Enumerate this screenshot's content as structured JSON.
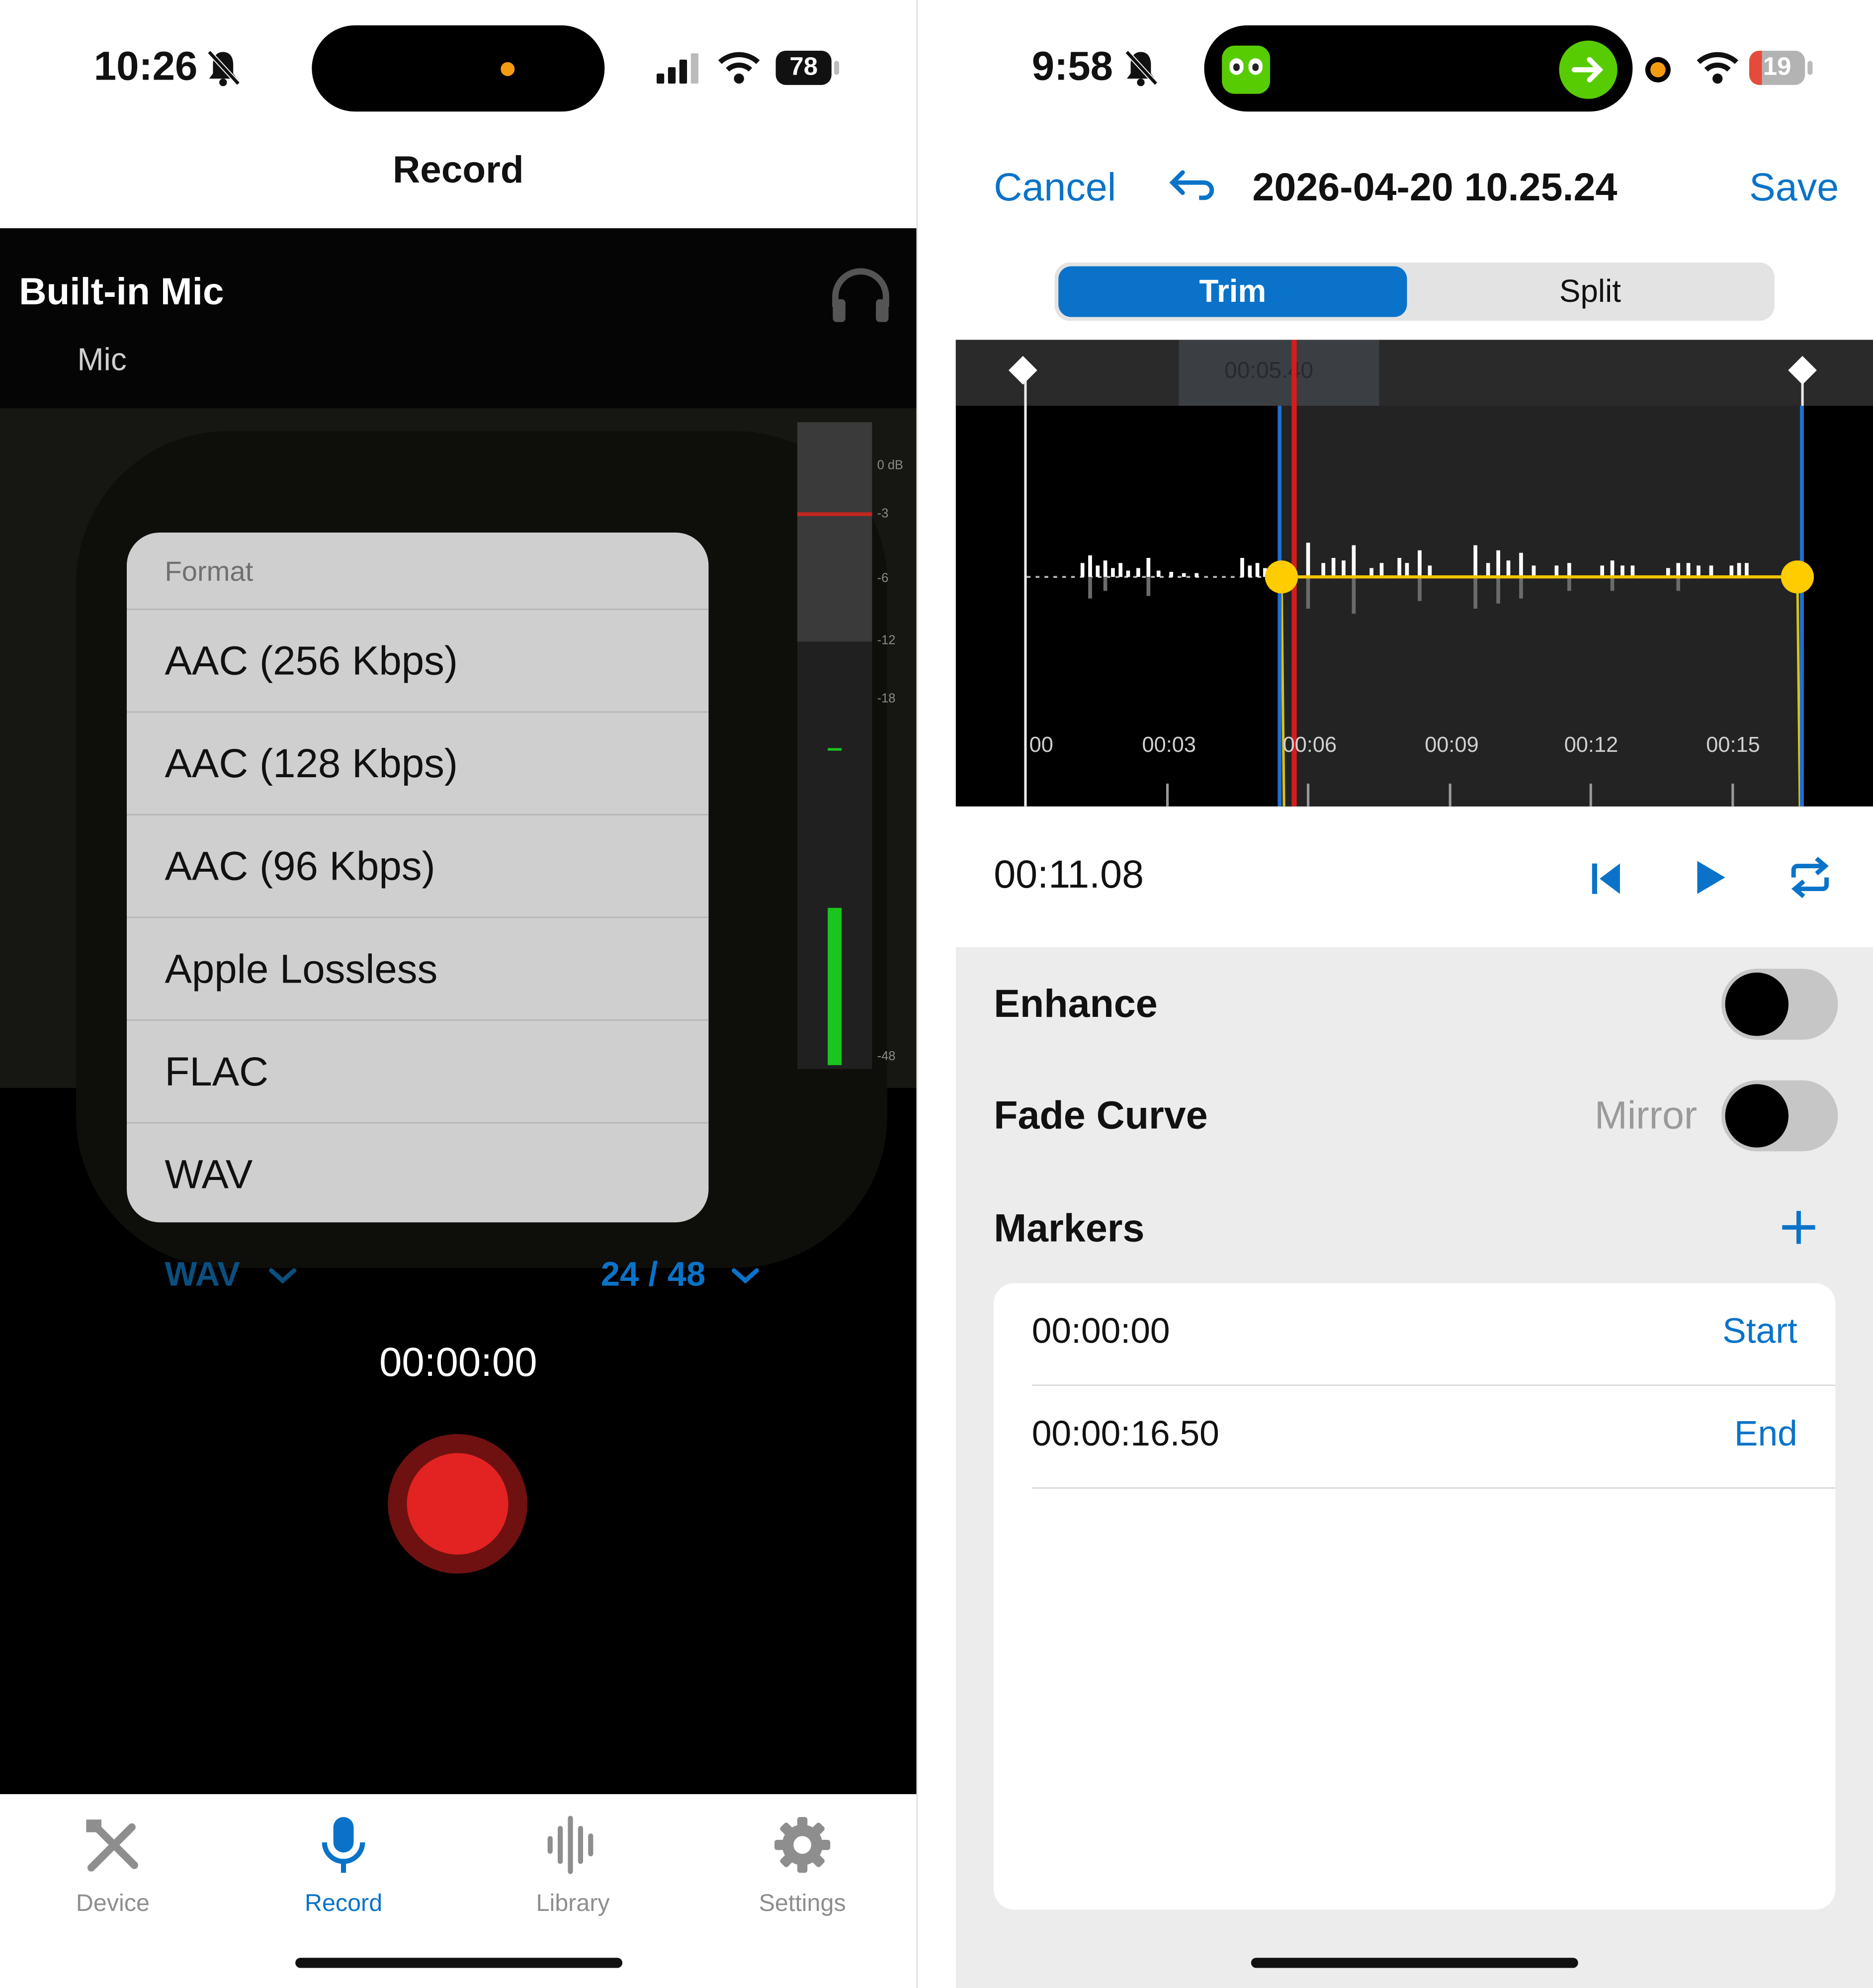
{
  "left": {
    "status": {
      "time": "10:26",
      "battery": "78"
    },
    "nav_title": "Record",
    "input": {
      "title": "Built-in Mic",
      "subtitle": "Mic"
    },
    "meter_labels": [
      "0 dB",
      "-3",
      "-6",
      "-12",
      "-18",
      "-48"
    ],
    "format_menu": {
      "header": "Format",
      "items": [
        "AAC (256 Kbps)",
        "AAC (128 Kbps)",
        "AAC (96 Kbps)",
        "Apple Lossless",
        "FLAC",
        "WAV"
      ]
    },
    "format_value": "WAV",
    "quality_value": "24 / 48",
    "timer": "00:00:00",
    "tabs": [
      {
        "label": "Device",
        "icon": "tools-icon"
      },
      {
        "label": "Record",
        "icon": "microphone-icon"
      },
      {
        "label": "Library",
        "icon": "waveform-icon"
      },
      {
        "label": "Settings",
        "icon": "gear-icon"
      }
    ]
  },
  "right": {
    "status": {
      "time": "9:58",
      "battery": "19"
    },
    "nav": {
      "cancel": "Cancel",
      "title": "2026-04-20 10.25.24",
      "save": "Save"
    },
    "segments": {
      "trim": "Trim",
      "split": "Split"
    },
    "playhead_label": "00:05.40",
    "time_ticks": [
      "00",
      "00:03",
      "00:06",
      "00:09",
      "00:12",
      "00:15"
    ],
    "position": "00:11.08",
    "enhance_label": "Enhance",
    "fade_label": "Fade Curve",
    "fade_value": "Mirror",
    "markers_label": "Markers",
    "markers": [
      {
        "time": "00:00:00",
        "kind": "Start"
      },
      {
        "time": "00:00:16.50",
        "kind": "End"
      }
    ]
  },
  "colors": {
    "accent": "#0a73c9",
    "record": "#e32222",
    "meter_green": "#19c51e",
    "trim_handle": "#ffcc00"
  }
}
